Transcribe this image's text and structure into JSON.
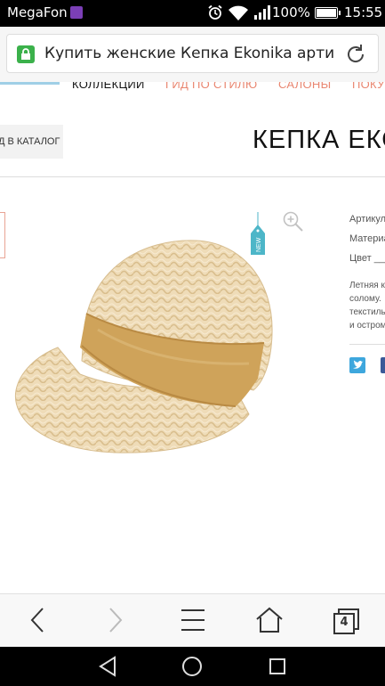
{
  "status_bar": {
    "carrier": "MegaFon",
    "battery": "100%",
    "time": "15:55"
  },
  "address_bar": {
    "url_text": "Купить женские Кепка Ekonika артикул"
  },
  "site_nav": {
    "items": [
      "КОЛЛЕКЦИИ",
      "ГИД ПО СТИЛЮ",
      "САЛОНЫ",
      "ПОКУ"
    ]
  },
  "catalog_button": "Д В КАТАЛОГ",
  "page_title": "КЕПКА ЕКО",
  "product": {
    "new_badge": "NEW",
    "attributes": [
      "Артикул",
      "Материа",
      "Цвет ___"
    ],
    "description": [
      "Летняя к",
      "солому.",
      "текстиль",
      "и остром"
    ]
  },
  "browser_bar": {
    "tab_count": "4"
  },
  "colors": {
    "accent_nav": "#e98670",
    "lock_green": "#3bb14b",
    "twitter": "#3ea7dd",
    "facebook": "#3b5998"
  }
}
